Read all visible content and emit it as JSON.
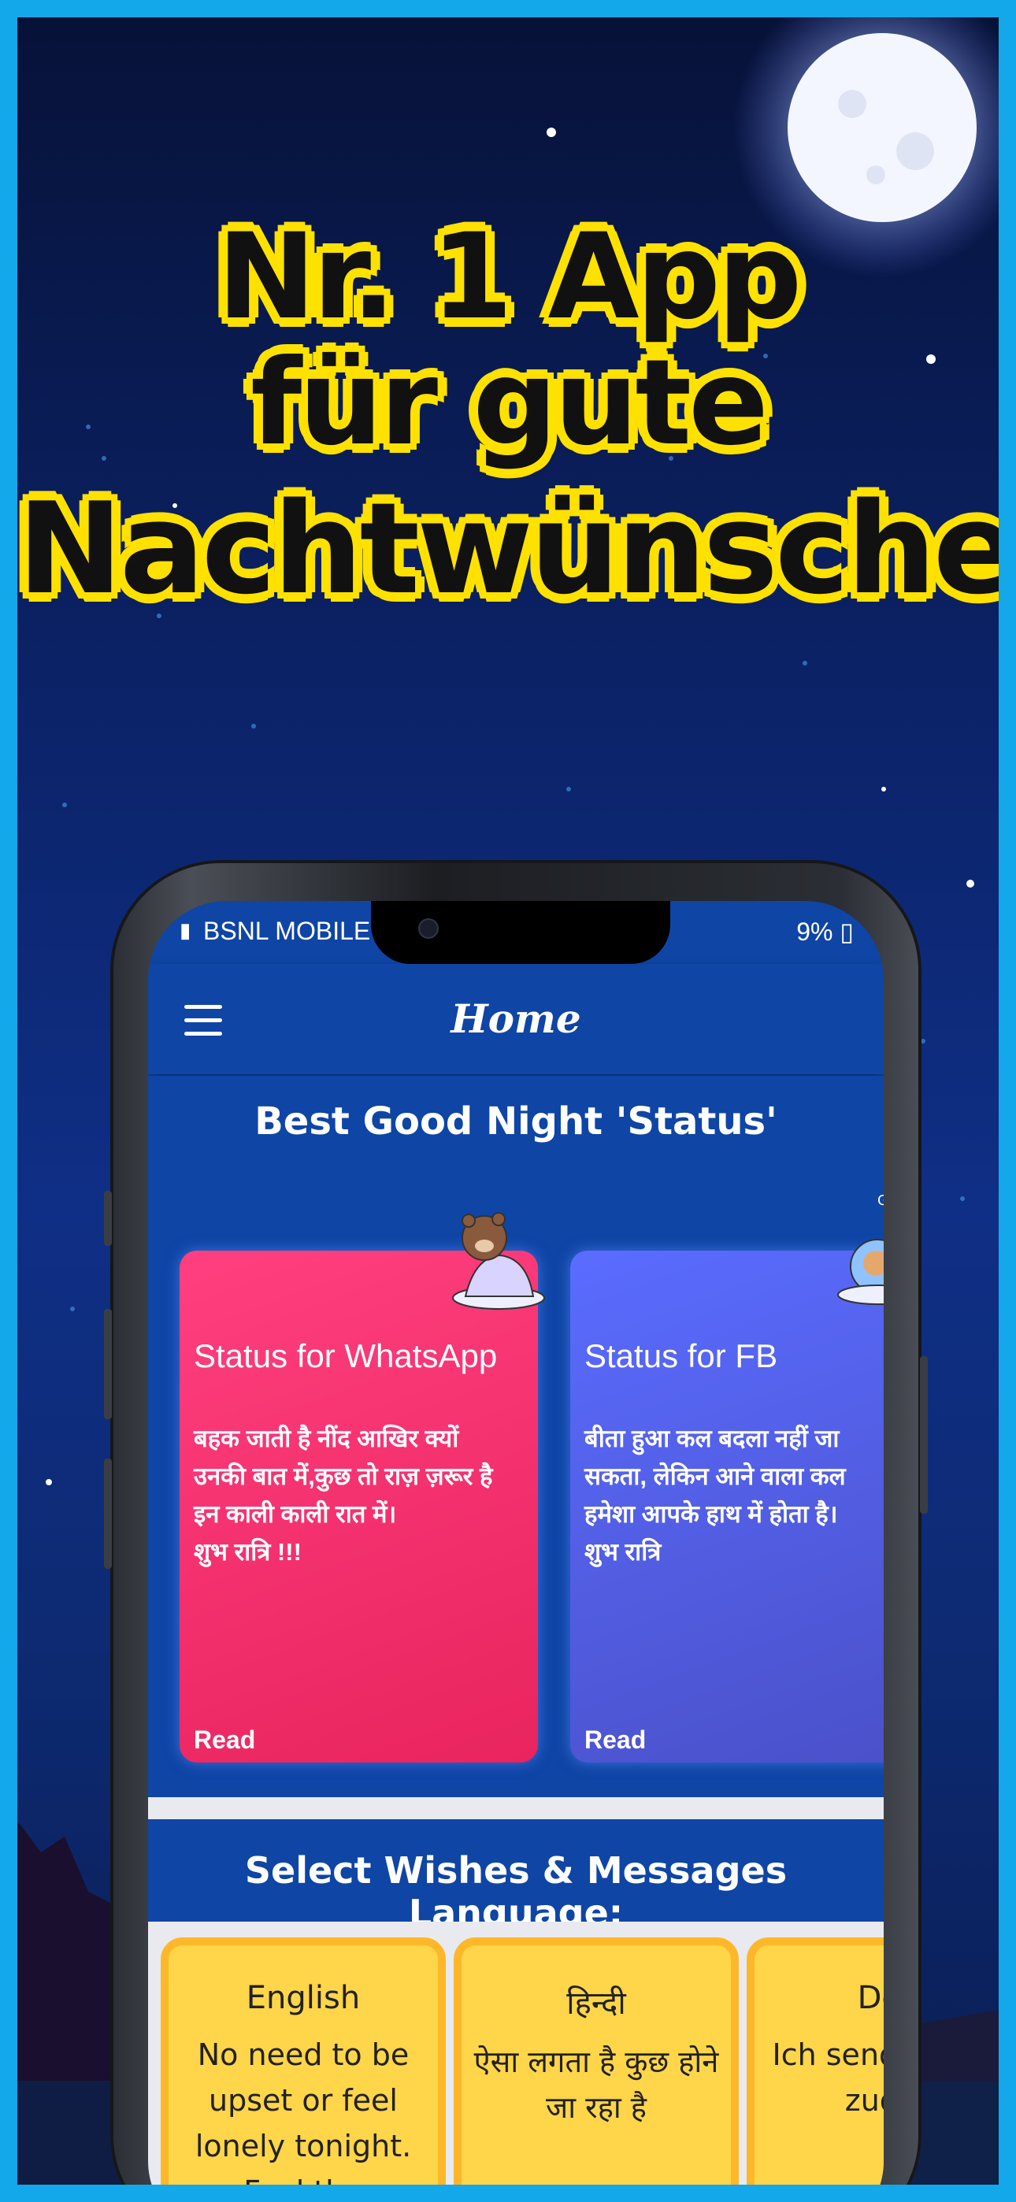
{
  "headline": {
    "line1": "Nr. 1 App",
    "line2": "für gute",
    "line3": "Nachtwünsche"
  },
  "status_bar": {
    "carrier": "BSNL MOBILE",
    "battery": "9%"
  },
  "app_bar": {
    "title": "Home"
  },
  "status_section": {
    "title": "Best Good Night 'Status'",
    "cards": [
      {
        "heading": "Status for WhatsApp",
        "text": "बहक जाती है नींद आखिर क्यों\nउनकी बात में,कुछ तो राज़ ज़रूर है\nइन काली काली रात में।\nशुभ रात्रि !!!",
        "action": "Read"
      },
      {
        "heading": "Status for FB",
        "text": "बीता हुआ कल बदला नहीं जा\nसकता, लेकिन आने वाला कल\nहमेशा आपके हाथ में होता है।\nशुभ रात्रि",
        "action": "Read"
      }
    ]
  },
  "language_section": {
    "title": "Select Wishes & Messages Language:",
    "languages": [
      {
        "name": "English",
        "text": "No need to be upset or feel lonely tonight. Feel the"
      },
      {
        "name": "हिन्दी",
        "text": "ऐसा लगता है कुछ होने जा रहा है"
      },
      {
        "name": "Deu",
        "text": "Ich send Wolke, zudec"
      }
    ]
  },
  "colors": {
    "app_blue": "#0f45a5",
    "headline_yellow": "#ffe100",
    "whatsapp_card": "#ff3f7f",
    "fb_card": "#5a6cff",
    "lang_card": "#ffd54a"
  }
}
